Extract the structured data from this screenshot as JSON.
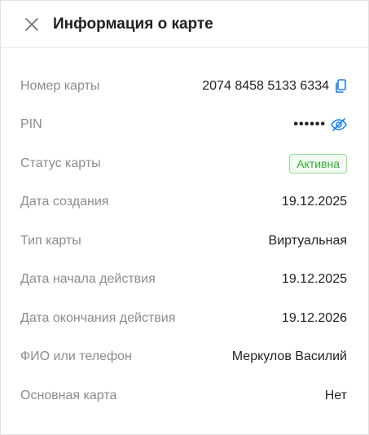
{
  "header": {
    "title": "Информация о карте"
  },
  "rows": [
    {
      "label": "Номер карты",
      "value": "2074 8458 5133 6334"
    },
    {
      "label": "PIN",
      "value": "••••••"
    },
    {
      "label": "Статус карты",
      "value": "Активна"
    },
    {
      "label": "Дата создания",
      "value": "19.12.2025"
    },
    {
      "label": "Тип карты",
      "value": "Виртуальная"
    },
    {
      "label": "Дата начала действия",
      "value": "19.12.2025"
    },
    {
      "label": "Дата окончания действия",
      "value": "19.12.2026"
    },
    {
      "label": "ФИО или телефон",
      "value": "Меркулов Василий"
    },
    {
      "label": "Основная карта",
      "value": "Нет"
    }
  ],
  "icons": {
    "close": "close-icon",
    "copy": "copy-icon",
    "visibility": "eye-off-icon"
  },
  "colors": {
    "accent": "#1a7fe0",
    "status_active": "#3aa83a"
  }
}
